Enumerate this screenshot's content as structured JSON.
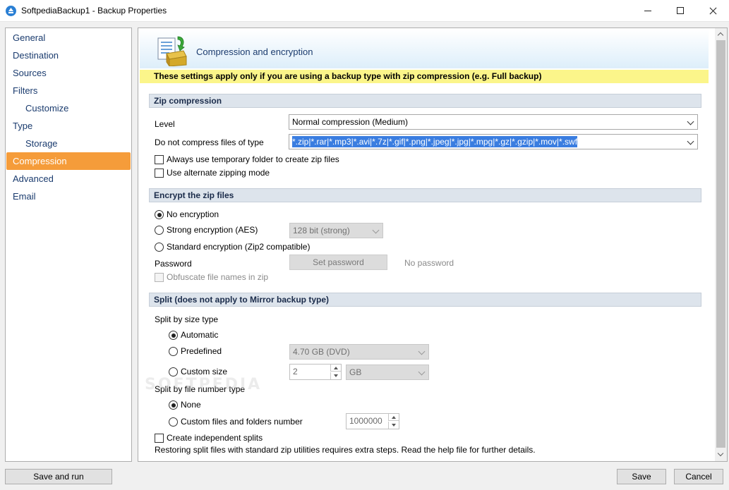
{
  "window": {
    "title": "SoftpediaBackup1 - Backup Properties"
  },
  "sidebar": {
    "items": [
      {
        "label": "General"
      },
      {
        "label": "Destination"
      },
      {
        "label": "Sources"
      },
      {
        "label": "Filters"
      },
      {
        "label": "Customize"
      },
      {
        "label": "Type"
      },
      {
        "label": "Storage"
      },
      {
        "label": "Compression"
      },
      {
        "label": "Advanced"
      },
      {
        "label": "Email"
      }
    ],
    "active": "Compression"
  },
  "header": {
    "title": "Compression and encryption",
    "notice": "These settings apply only if you are using a backup type with zip compression (e.g. Full backup)"
  },
  "zip": {
    "section": "Zip compression",
    "level_label": "Level",
    "level_value": "Normal compression (Medium)",
    "nocompress_label": "Do not compress files of type",
    "nocompress_value": "*.zip|*.rar|*.mp3|*.avi|*.7z|*.gif|*.png|*.jpeg|*.jpg|*.mpg|*.gz|*.gzip|*.mov|*.swf",
    "temp_folder": "Always use temporary folder to create zip files",
    "alt_mode": "Use alternate zipping mode"
  },
  "encrypt": {
    "section": "Encrypt the zip files",
    "none": "No encryption",
    "strong": "Strong encryption (AES)",
    "strength_value": "128 bit (strong)",
    "standard": "Standard encryption (Zip2 compatible)",
    "password_label": "Password",
    "set_password": "Set password",
    "password_status": "No password",
    "obfuscate": "Obfuscate file names in zip"
  },
  "split": {
    "section": "Split (does not apply to Mirror backup type)",
    "by_size_label": "Split by size type",
    "automatic": "Automatic",
    "predefined": "Predefined",
    "predefined_value": "4.70 GB (DVD)",
    "custom_size": "Custom size",
    "custom_size_value": "2",
    "custom_unit": "GB",
    "by_number_label": "Split by file number type",
    "none": "None",
    "custom_number": "Custom files and folders number",
    "custom_number_value": "1000000",
    "independent": "Create independent splits",
    "note": "Restoring split files with standard zip utilities requires extra steps. Read the help file for further details."
  },
  "footer": {
    "save_and_run": "Save and run",
    "save": "Save",
    "cancel": "Cancel"
  },
  "watermark": "SOFTPEDIA"
}
